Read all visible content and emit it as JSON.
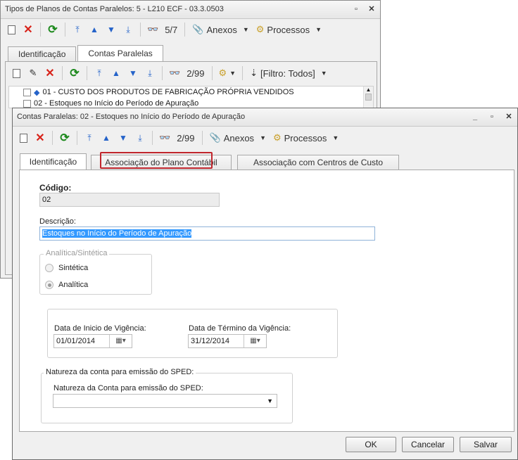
{
  "back_window": {
    "title": "Tipos de Planos de Contas Paralelos: 5 - L210 ECF - 03.3.0503",
    "record_pos": "5/7",
    "anexos": "Anexos",
    "processos": "Processos",
    "tabs": [
      "Identificação",
      "Contas Paralelas"
    ],
    "inner_toolbar": {
      "record_pos": "2/99",
      "filter": "[Filtro: Todos]"
    },
    "tree_items": [
      "01 - CUSTO DOS PRODUTOS DE FABRICAÇÃO PRÓPRIA VENDIDOS",
      "02 - Estoques no Início do Período de Apuração"
    ]
  },
  "front_window": {
    "title": "Contas Paralelas: 02 - Estoques no Início do Período de Apuração",
    "record_pos": "2/99",
    "anexos": "Anexos",
    "processos": "Processos",
    "tabs": [
      "Identificação",
      "Associação do Plano Contábil",
      "Associação com Centros de Custo"
    ],
    "form": {
      "codigo_label": "Código:",
      "codigo_value": "02",
      "descricao_label": "Descrição:",
      "descricao_value": "Estoques no Início do Período de Apuração",
      "tipo_group": "Analítica/Sintética",
      "radio_sintetica": "Sintética",
      "radio_analitica": "Analítica",
      "data_inicio_label": "Data de Inicio de Vigência:",
      "data_inicio_value": "01/01/2014",
      "data_termino_label": "Data de Término da Vigência:",
      "data_termino_value": "31/12/2014",
      "natureza_group": "Natureza da conta para emissão do SPED:",
      "natureza_label": "Natureza da Conta para emissão do SPED:",
      "natureza_value": ""
    },
    "buttons": {
      "ok": "OK",
      "cancelar": "Cancelar",
      "salvar": "Salvar"
    }
  },
  "colors": {
    "highlight_tab_border": "#c0262d",
    "selection": "#3399ff"
  }
}
